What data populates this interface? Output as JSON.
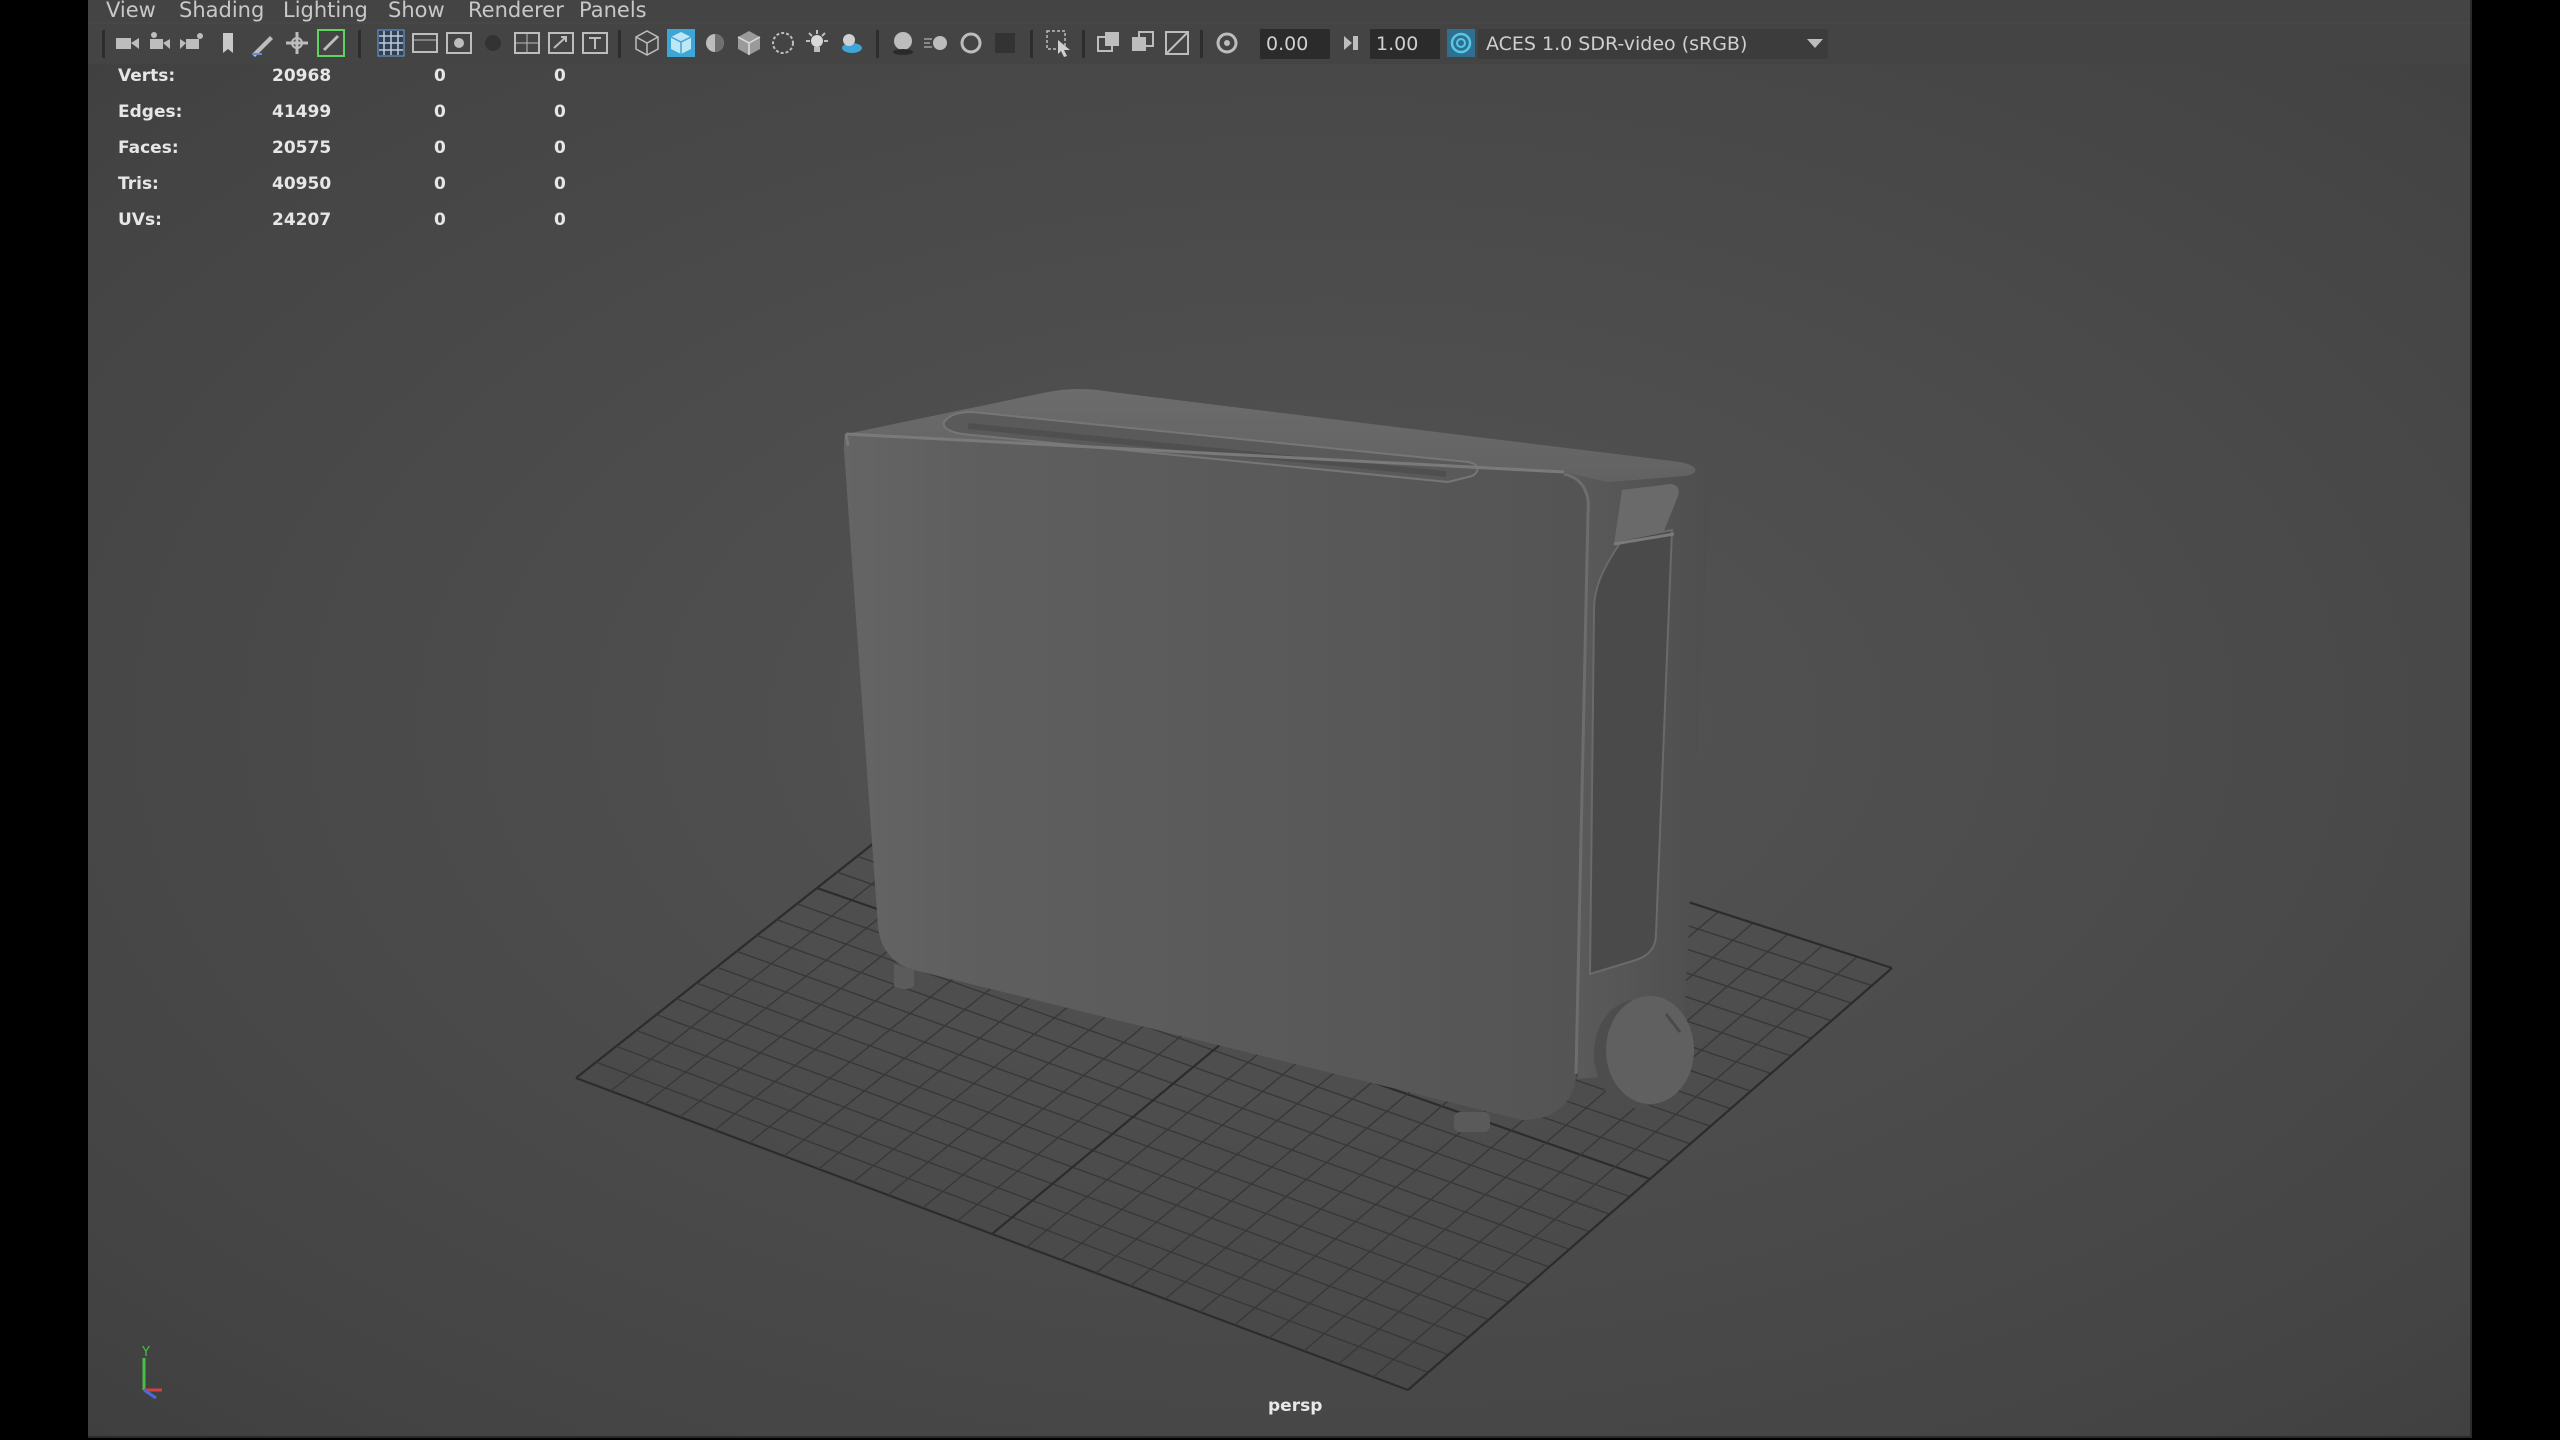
{
  "menu": {
    "items": [
      "View",
      "Shading",
      "Lighting",
      "Show",
      "Renderer",
      "Panels"
    ]
  },
  "toolbar": {
    "exposure_value": "0.00",
    "gamma_value": "1.00",
    "color_space": "ACES 1.0 SDR-video (sRGB)",
    "icons": [
      "select-camera-icon",
      "camera-attributes-icon",
      "bookmarks-icon",
      "image-plane-icon",
      "grease-pencil-icon",
      "2d-pan-zoom-icon",
      "snap-icon",
      "grid-icon",
      "film-gate-icon",
      "resolution-gate-icon",
      "gate-mask-icon",
      "field-chart-icon",
      "safe-action-icon",
      "safe-title-icon",
      "wireframe-icon",
      "smooth-shade-icon",
      "default-material-icon",
      "textured-icon",
      "xray-icon",
      "lights-icon",
      "shadows-icon",
      "ambient-occlusion-icon",
      "motion-blur-icon",
      "antialiasing-icon",
      "depth-of-field-icon",
      "isolate-select-icon",
      "xray-joints-icon",
      "xray-active-icon",
      "backface-culling-icon",
      "exposure-icon",
      "gamma-icon",
      "color-management-icon"
    ],
    "colors": {
      "active_blue": "#3ea6d6",
      "active_green": "#5fd35f"
    }
  },
  "hud": {
    "stats": [
      {
        "label": "Verts:",
        "value": "20968",
        "c1": "0",
        "c2": "0"
      },
      {
        "label": "Edges:",
        "value": "41499",
        "c1": "0",
        "c2": "0"
      },
      {
        "label": "Faces:",
        "value": "20575",
        "c1": "0",
        "c2": "0"
      },
      {
        "label": "Tris:",
        "value": "40950",
        "c1": "0",
        "c2": "0"
      },
      {
        "label": "UVs:",
        "value": "24207",
        "c1": "0",
        "c2": "0"
      }
    ],
    "camera": "persp"
  },
  "axis": {
    "y": "Y",
    "colors": {
      "x": "#d24040",
      "y": "#48c048",
      "z": "#4a6be0"
    }
  }
}
